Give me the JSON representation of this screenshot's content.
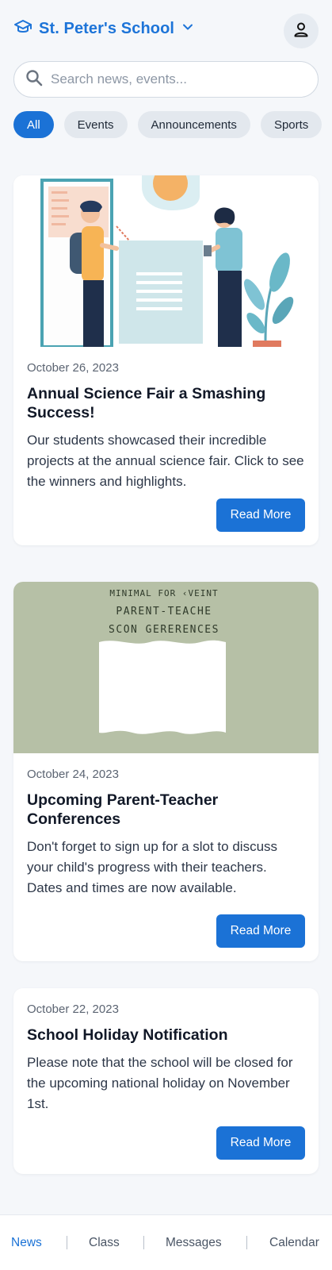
{
  "header": {
    "school_name": "St. Peter's School"
  },
  "search": {
    "placeholder": "Search news, events..."
  },
  "filters": [
    {
      "label": "All",
      "active": true
    },
    {
      "label": "Events",
      "active": false
    },
    {
      "label": "Announcements",
      "active": false
    },
    {
      "label": "Sports",
      "active": false
    }
  ],
  "posts": [
    {
      "date": "October 26, 2023",
      "title": "Annual Science Fair a Smashing Success!",
      "text": "Our students showcased their incredible projects at the annual science fair. Click to see the winners and highlights.",
      "button": "Read More"
    },
    {
      "date": "October 24, 2023",
      "title": "Upcoming Parent-Teacher Conferences",
      "text": "Don't forget to sign up for a slot to discuss your child's progress with their teachers. Dates and times are now available.",
      "button": "Read More",
      "image_text": [
        "MINIMAL FOR ‹VEINT",
        "PARENT-TEACHE",
        "SCON GERERENCES"
      ]
    },
    {
      "date": "October 22, 2023",
      "title": "School Holiday Notification",
      "text": "Please note that the school will be closed for the upcoming national holiday on November 1st.",
      "button": "Read More"
    }
  ],
  "nav": [
    {
      "label": "News",
      "active": true
    },
    {
      "label": "Class",
      "active": false
    },
    {
      "label": "Messages",
      "active": false
    },
    {
      "label": "Calendar",
      "active": false
    }
  ],
  "colors": {
    "accent": "#1b72d6",
    "background": "#f5f7fa"
  }
}
